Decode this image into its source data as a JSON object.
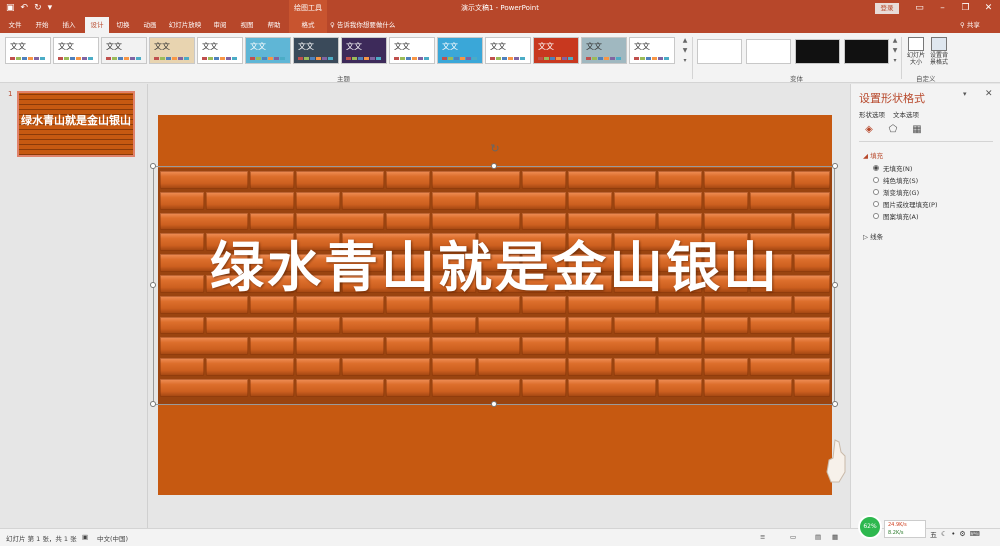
{
  "app": {
    "doc_title": "演示文稿1  -  PowerPoint",
    "contextual_group": "绘图工具",
    "login": "登录",
    "share": "共享",
    "tell_me": "告诉我你想要做什么"
  },
  "tabs": [
    {
      "label": "文件"
    },
    {
      "label": "开始"
    },
    {
      "label": "插入"
    },
    {
      "label": "设计"
    },
    {
      "label": "切换"
    },
    {
      "label": "动画"
    },
    {
      "label": "幻灯片放映"
    },
    {
      "label": "审阅"
    },
    {
      "label": "视图"
    },
    {
      "label": "帮助"
    },
    {
      "label": "格式"
    }
  ],
  "ribbon": {
    "theme_sample": "文文",
    "themes_label": "主题",
    "variants_label": "变体",
    "customize_label": "自定义",
    "slide_size": "幻灯片\n大小",
    "format_bg": "设置背\n景格式",
    "theme_colors": [
      "#ffffff",
      "#ffffff",
      "#f2f2f2",
      "#e8d4b0",
      "#ffffff",
      "#5fb6d6",
      "#3a4a5a",
      "#3d2a5a",
      "#ffffff",
      "#3aa7d8",
      "#ffffff",
      "#c8381f",
      "#a0b8c0",
      "#ffffff"
    ],
    "variant_colors": [
      "#ffffff",
      "#ffffff",
      "#111111",
      "#111111"
    ]
  },
  "thumbs": {
    "slide_number": "1",
    "thumb_text": "绿水青山就是金山银山"
  },
  "slide": {
    "headline": "绿水青山就是金山银山"
  },
  "format_pane": {
    "title": "设置形状格式",
    "tab_shape": "形状选项",
    "tab_text": "文本选项",
    "fill_section": "填充",
    "options": [
      "无填充(N)",
      "纯色填充(S)",
      "渐变填充(G)",
      "图片或纹理填充(P)",
      "图案填充(A)"
    ],
    "selected_option": 0,
    "line_section": "线条"
  },
  "status": {
    "slide_info": "幻灯片 第 1 张，共 1 张",
    "language": "中文(中国)",
    "gauge": "62%",
    "net_up": "24.9K/s",
    "net_down": "8.2K/s",
    "ime": "五"
  }
}
